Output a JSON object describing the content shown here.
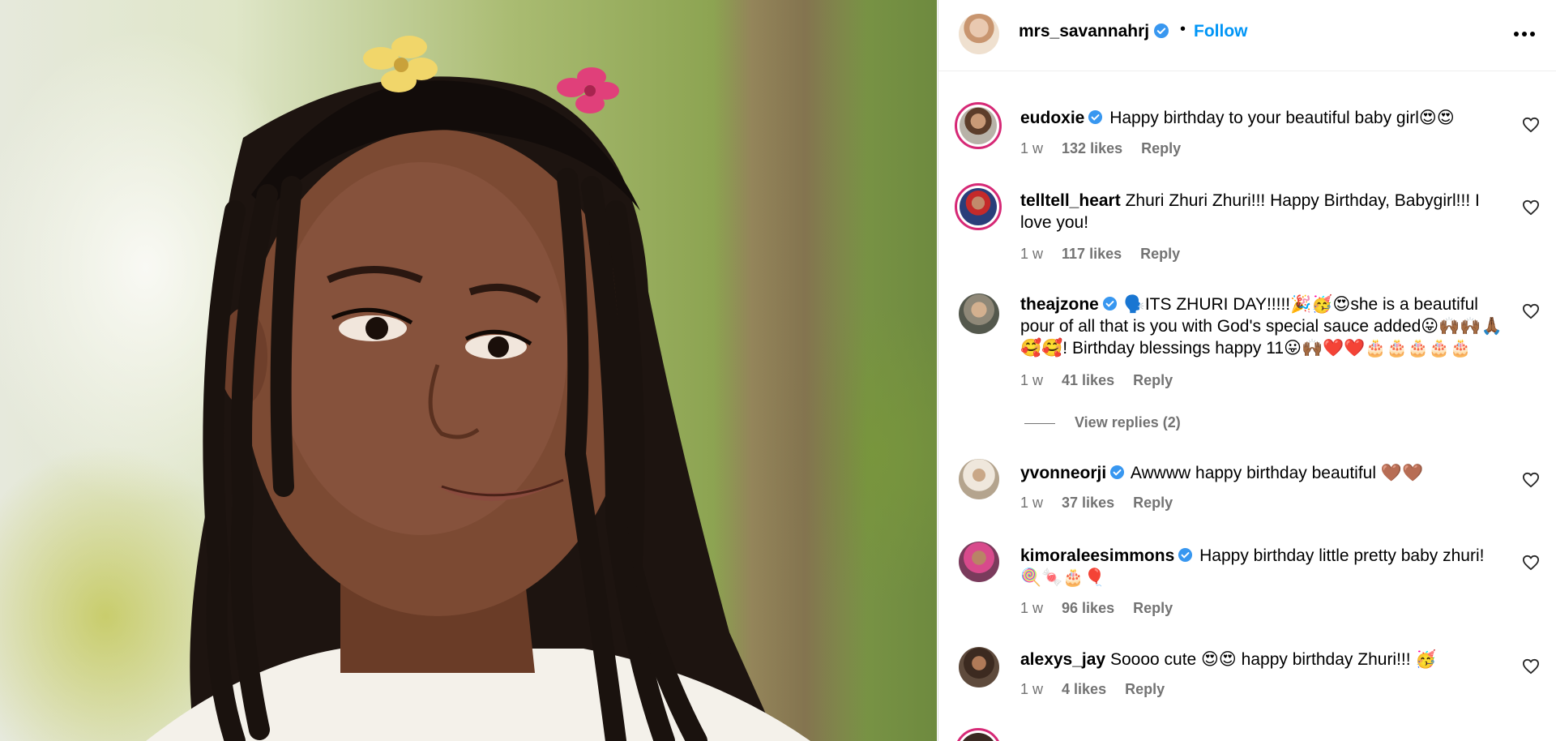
{
  "post": {
    "username": "mrs_savannahrj",
    "separator": "•",
    "follow_label": "Follow"
  },
  "comments": [
    {
      "username": "eudoxie",
      "verified": true,
      "text": "Happy birthday to your beautiful baby girl😍😍",
      "time": "1 w",
      "likes": "132 likes",
      "reply": "Reply"
    },
    {
      "username": "telltell_heart",
      "verified": false,
      "text": "Zhuri Zhuri Zhuri!!! Happy Birthday, Babygirl!!! I love you!",
      "time": "1 w",
      "likes": "117 likes",
      "reply": "Reply"
    },
    {
      "username": "theajzone",
      "verified": true,
      "text": "🗣️ITS ZHURI DAY!!!!!🎉🥳😍she is a beautiful pour of all that is you with God's special sauce added😛🙌🏾🙌🏾🙏🏾🥰🥰! Birthday blessings happy 11😛🙌🏾❤️❤️🎂🎂🎂🎂🎂",
      "time": "1 w",
      "likes": "41 likes",
      "reply": "Reply",
      "view_replies": "View replies (2)"
    },
    {
      "username": "yvonneorji",
      "verified": true,
      "text": "Awwww happy birthday beautiful 🤎🤎",
      "time": "1 w",
      "likes": "37 likes",
      "reply": "Reply"
    },
    {
      "username": "kimoraleesimmons",
      "verified": true,
      "text": "Happy birthday little pretty baby zhuri! 🍭🍬🎂🎈",
      "time": "1 w",
      "likes": "96 likes",
      "reply": "Reply"
    },
    {
      "username": "alexys_jay",
      "verified": false,
      "text": "Soooo cute 😍😍 happy birthday Zhuri!!! 🥳",
      "time": "1 w",
      "likes": "4 likes",
      "reply": "Reply"
    }
  ],
  "icons": {
    "verified": "verified-badge-icon",
    "more": "more-options-icon",
    "heart": "heart-outline-icon"
  },
  "colors": {
    "accent": "#0095f6",
    "verified": "#3897f0",
    "meta": "#737373",
    "story_ring": "#d62976"
  }
}
